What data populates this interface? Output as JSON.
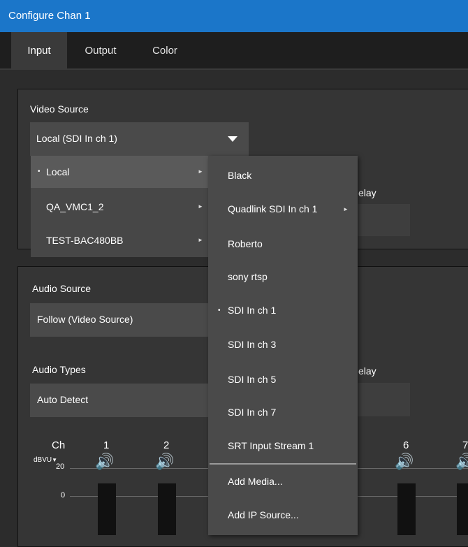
{
  "window": {
    "title": "Configure Chan 1"
  },
  "tabs": [
    {
      "label": "Input",
      "active": true
    },
    {
      "label": "Output",
      "active": false
    },
    {
      "label": "Color",
      "active": false
    }
  ],
  "video": {
    "label": "Video Source",
    "selected": "Local (SDI In ch 1)",
    "delay_label_fragment": "elay"
  },
  "audio": {
    "source_label": "Audio Source",
    "source_value": "Follow (Video Source)",
    "types_label": "Audio Types",
    "types_value": "Auto Detect",
    "delay_label_fragment": "elay"
  },
  "mixer": {
    "ch_label": "Ch",
    "units": "dBVU",
    "scale": [
      "20",
      "0"
    ],
    "channels": [
      "1",
      "2",
      "6",
      "7"
    ]
  },
  "menu_level1": [
    {
      "label": "Local",
      "bullet": "•",
      "submenu": true,
      "highlighted": true
    },
    {
      "label": "QA_VMC1_2",
      "submenu": true
    },
    {
      "label": "TEST-BAC480BB",
      "submenu": true
    }
  ],
  "menu_level2": [
    {
      "label": "Black"
    },
    {
      "label": "Quadlink SDI In ch 1",
      "submenu": true
    },
    {
      "label": "Roberto"
    },
    {
      "label": "sony rtsp"
    },
    {
      "label": "SDI In ch 1",
      "bullet": "•",
      "selected": true
    },
    {
      "label": "SDI In ch 3"
    },
    {
      "label": "SDI In ch 5"
    },
    {
      "label": "SDI In ch 7"
    },
    {
      "label": "SRT Input Stream 1"
    },
    {
      "label": "Add Media..."
    },
    {
      "label": "Add IP Source..."
    }
  ],
  "icons": {
    "dropdown": "caret-down-icon",
    "submenu": "chevron-right-icon",
    "speaker": "speaker-icon"
  },
  "colors": {
    "accent": "#1b76c9"
  }
}
